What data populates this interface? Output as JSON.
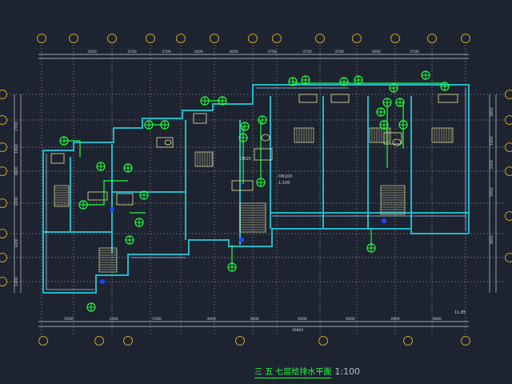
{
  "drawing": {
    "title": "三 五 七层给排水平面",
    "scale": "1:100",
    "colors": {
      "background": "#1e2330",
      "grid": "#2a3040",
      "axis_bubble": "#c8a028",
      "dimension": "#c8cfe0",
      "wall": "#22b8c8",
      "wall_inner": "#8ad4ff",
      "pipe": "#1eff3c",
      "fixture": "#e6e6a0",
      "stair": "#e6e6a0",
      "marker": "#1848ff"
    }
  },
  "dimensions": {
    "top": [
      "2600",
      "3700",
      "3700",
      "3400",
      "3600",
      "3700",
      "4700",
      "3700",
      "3600",
      "3700"
    ],
    "bottom": [
      "5000",
      "3300",
      "5300",
      "3900",
      "3400",
      "6900",
      "6900",
      "2800",
      "3900"
    ],
    "bottom_total": "26800",
    "left": [
      "2700",
      "1800",
      "3800",
      "3300",
      "3400",
      "1400"
    ],
    "right": [
      "4800",
      "1800",
      "3300",
      "5900",
      "3600"
    ],
    "notes": [
      "DN100",
      "1:100",
      "DN25",
      "11.85"
    ]
  }
}
